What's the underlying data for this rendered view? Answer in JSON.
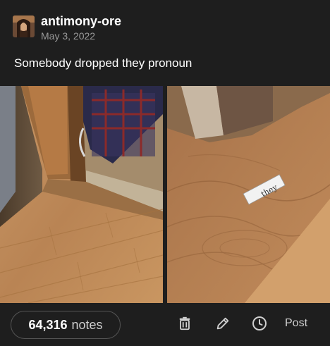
{
  "post": {
    "username": "antimony-ore",
    "date": "May 3, 2022",
    "caption": "Somebody dropped they pronoun",
    "magnet_word": "they"
  },
  "footer": {
    "notes_count": "64,316",
    "notes_label": "notes",
    "post_label": "Post",
    "icons": [
      "trash-icon",
      "pencil-icon",
      "clock-icon"
    ]
  },
  "colors": {
    "background": "#1e1e1e",
    "text": "#ffffff",
    "muted": "#9a9a9a",
    "pill_border": "#555555"
  }
}
